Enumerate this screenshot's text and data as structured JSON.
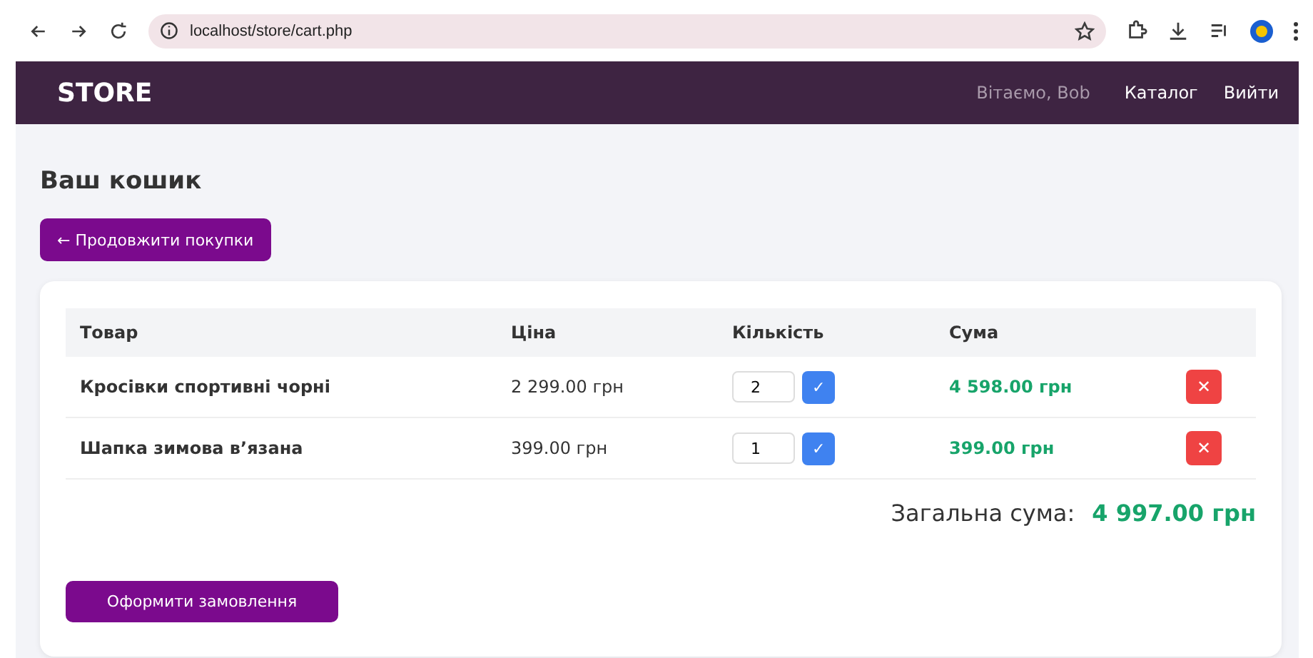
{
  "browser": {
    "url": "localhost/store/cart.php"
  },
  "navbar": {
    "brand": "STORE",
    "greeting": "Вітаємо, Bob",
    "links": [
      "Каталог",
      "Вийти"
    ]
  },
  "page": {
    "title": "Ваш кошик",
    "back_button": "← Продовжити покупки"
  },
  "table": {
    "columns": [
      "Товар",
      "Ціна",
      "Кількість",
      "Сума"
    ],
    "rows": [
      {
        "product": "Кросівки спортивні чорні",
        "price": "2 299.00 грн",
        "quantity": "2",
        "update": "✓",
        "total": "4 598.00 грн",
        "remove": "✕"
      },
      {
        "product": "Шапка зимова в’язана",
        "price": "399.00 грн",
        "quantity": "1",
        "update": "✓",
        "total": "399.00 грн",
        "remove": "✕"
      }
    ]
  },
  "summary": {
    "label": "Загальна сума:",
    "value": "4 997.00 грн"
  },
  "checkout_button": "Оформити замовлення"
}
